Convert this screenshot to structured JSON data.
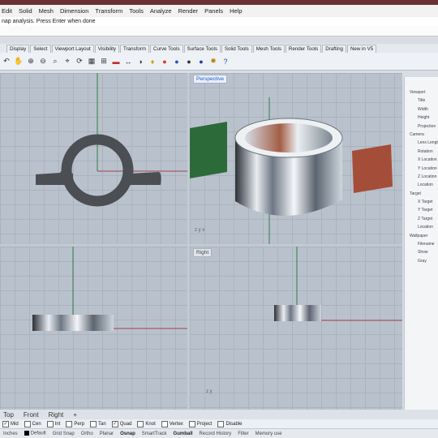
{
  "menu": [
    "Edit",
    "Solid",
    "Mesh",
    "Dimension",
    "Transform",
    "Tools",
    "Analyze",
    "Render",
    "Panels",
    "Help"
  ],
  "command": {
    "history_line": "nap analysis. Press Enter when done"
  },
  "toolbar_tabs": [
    "Display",
    "Select",
    "Viewport Layout",
    "Visibility",
    "Transform",
    "Curve Tools",
    "Surface Tools",
    "Solid Tools",
    "Mesh Tools",
    "Render Tools",
    "Drafting",
    "New in V5"
  ],
  "toolbar_icons": [
    "undo-icon",
    "pan-icon",
    "zoom-in-icon",
    "zoom-out-icon",
    "zoom-window-icon",
    "zoom-extents-icon",
    "rotate-view-icon",
    "grid-icon",
    "4-view-icon",
    "shaded-icon",
    "dimension-icon",
    "rendered-icon",
    "light-bulb-icon",
    "material-ball-icon",
    "sphere-icon",
    "sphere-dark-icon",
    "help-icon"
  ],
  "viewports": {
    "top": {
      "label": ""
    },
    "perspective": {
      "label": "Perspective"
    },
    "front": {
      "label": ""
    },
    "right": {
      "label": "Right"
    }
  },
  "right_panel": {
    "section_viewport": "Viewport",
    "viewport_rows": [
      "Title",
      "Width",
      "Height",
      "Projection"
    ],
    "section_camera": "Camera",
    "camera_rows": [
      "Lens Length",
      "Rotation",
      "X Location",
      "Y Location",
      "Z Location",
      "Location"
    ],
    "section_target": "Target",
    "target_rows": [
      "X Target",
      "Y Target",
      "Z Target",
      "Location"
    ],
    "section_wallpaper": "Wallpaper",
    "wallpaper_rows": [
      "Filename",
      "Show",
      "Gray"
    ]
  },
  "view_tabs": [
    "Top",
    "Front",
    "Right"
  ],
  "osnaps": [
    {
      "label": "Mid",
      "checked": true
    },
    {
      "label": "Cen",
      "checked": false
    },
    {
      "label": "Int",
      "checked": false
    },
    {
      "label": "Perp",
      "checked": false
    },
    {
      "label": "Tan",
      "checked": false
    },
    {
      "label": "Quad",
      "checked": true
    },
    {
      "label": "Knot",
      "checked": false
    },
    {
      "label": "Vertex",
      "checked": false
    },
    {
      "label": "Project",
      "checked": false
    },
    {
      "label": "Disable",
      "checked": false
    }
  ],
  "status": {
    "units": "Inches",
    "layer": "Default",
    "grid_snap": "Grid Snap",
    "ortho": "Ortho",
    "planar": "Planar",
    "osnap": "Osnap",
    "smarttrack": "SmartTrack",
    "gumball": "Gumball",
    "record_history": "Record History",
    "filter": "Filter",
    "memory": "Memory use"
  },
  "colors": {
    "title_bar": "#6a3033",
    "x_axis": "#a2414a",
    "y_axis": "#2f7d46"
  }
}
